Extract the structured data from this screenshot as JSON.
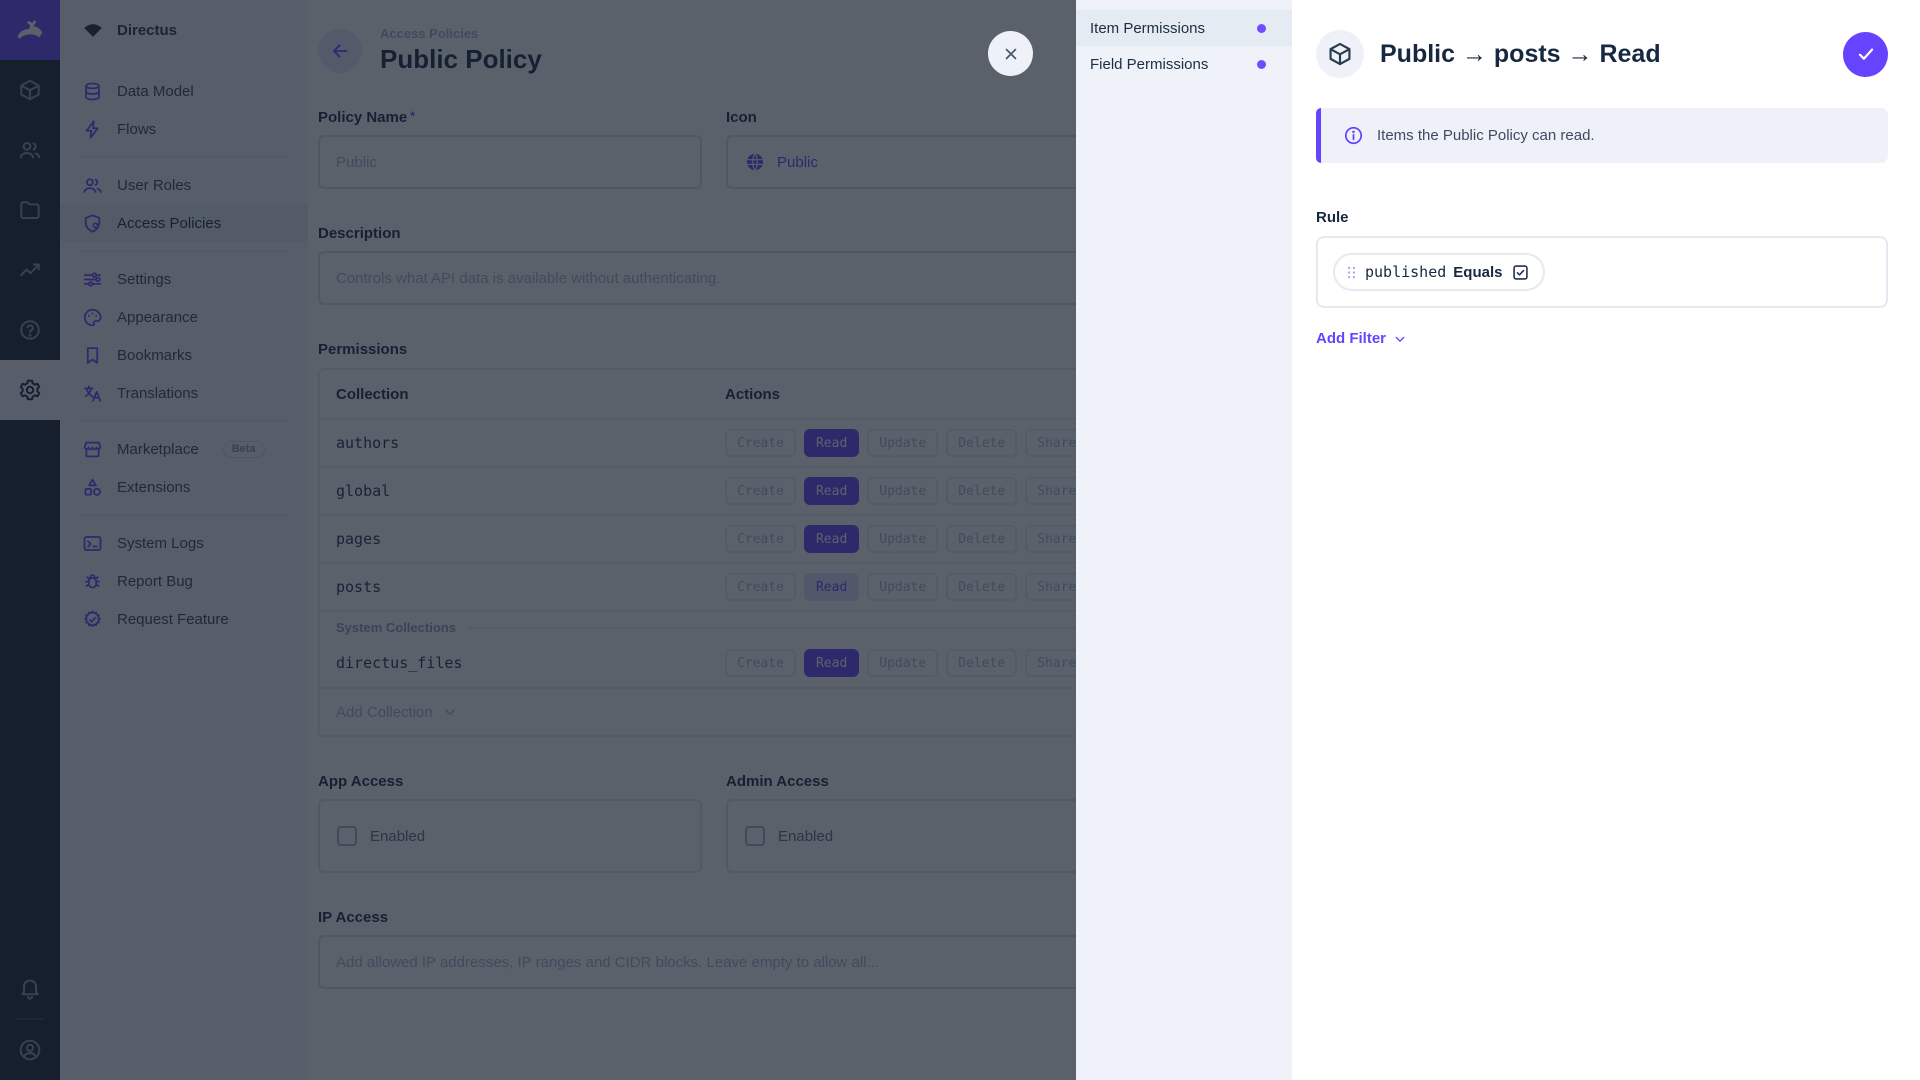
{
  "colors": {
    "accent": "#6644ff",
    "module_bar_bg": "#18222f",
    "navy": "#172940",
    "muted": "#a2b5cd",
    "nav_bg": "#f0f4f9"
  },
  "module_bar": {
    "logo_icon": "rabbit",
    "modules": [
      {
        "name": "content",
        "icon": "box"
      },
      {
        "name": "users",
        "icon": "users"
      },
      {
        "name": "files",
        "icon": "folder"
      },
      {
        "name": "insights",
        "icon": "insights"
      },
      {
        "name": "documentation",
        "icon": "help"
      },
      {
        "name": "settings",
        "icon": "gear",
        "active": true
      }
    ],
    "notifications_icon": "bell",
    "avatar_icon": "avatar"
  },
  "sidebar": {
    "project_name": "Directus",
    "project_icon": "fan",
    "groups": [
      {
        "items": [
          {
            "label": "Data Model",
            "icon": "database"
          },
          {
            "label": "Flows",
            "icon": "bolt"
          }
        ]
      },
      {
        "items": [
          {
            "label": "User Roles",
            "icon": "users"
          },
          {
            "label": "Access Policies",
            "icon": "shield-user",
            "active": true
          }
        ]
      },
      {
        "items": [
          {
            "label": "Settings",
            "icon": "tune"
          },
          {
            "label": "Appearance",
            "icon": "palette"
          },
          {
            "label": "Bookmarks",
            "icon": "bookmark"
          },
          {
            "label": "Translations",
            "icon": "translate"
          }
        ]
      },
      {
        "items": [
          {
            "label": "Marketplace",
            "icon": "storefront",
            "badge": "Beta"
          },
          {
            "label": "Extensions",
            "icon": "shapes"
          }
        ]
      },
      {
        "items": [
          {
            "label": "System Logs",
            "icon": "terminal"
          },
          {
            "label": "Report Bug",
            "icon": "bug"
          },
          {
            "label": "Request Feature",
            "icon": "new-releases"
          }
        ]
      }
    ]
  },
  "main": {
    "header": {
      "breadcrumb": "Access Policies",
      "title": "Public Policy"
    },
    "fields": {
      "policy_name": {
        "label": "Policy Name",
        "required_marker": "*",
        "value": "Public"
      },
      "icon": {
        "label": "Icon",
        "value": "Public",
        "glyph": "globe"
      },
      "description": {
        "label": "Description",
        "value": "Controls what API data is available without authenticating."
      }
    },
    "permissions": {
      "label": "Permissions",
      "columns": {
        "collection": "Collection",
        "actions": "Actions"
      },
      "actions": [
        "Create",
        "Read",
        "Update",
        "Delete",
        "Share"
      ],
      "rows": [
        {
          "collection": "authors",
          "read": "full"
        },
        {
          "collection": "global",
          "read": "full"
        },
        {
          "collection": "pages",
          "read": "full"
        },
        {
          "collection": "posts",
          "read": "custom"
        }
      ],
      "system_heading": "System Collections",
      "system_rows": [
        {
          "collection": "directus_files",
          "read": "full"
        }
      ],
      "add_collection_label": "Add Collection"
    },
    "app_access": {
      "label": "App Access",
      "checkbox_label": "Enabled",
      "checked": false
    },
    "admin_access": {
      "label": "Admin Access",
      "checkbox_label": "Enabled",
      "checked": false
    },
    "ip_access": {
      "label": "IP Access",
      "placeholder": "Add allowed IP addresses, IP ranges and CIDR blocks. Leave empty to allow all..."
    }
  },
  "drawer": {
    "nav": [
      {
        "label": "Item Permissions",
        "active": true
      },
      {
        "label": "Field Permissions"
      }
    ],
    "header": {
      "icon": "box",
      "title": "Public → posts → Read"
    },
    "info_banner": "Items the Public Policy can read.",
    "rule": {
      "label": "Rule",
      "filter": {
        "field": "published",
        "operator": "Equals",
        "value_checked": true
      }
    },
    "add_filter_label": "Add Filter"
  }
}
